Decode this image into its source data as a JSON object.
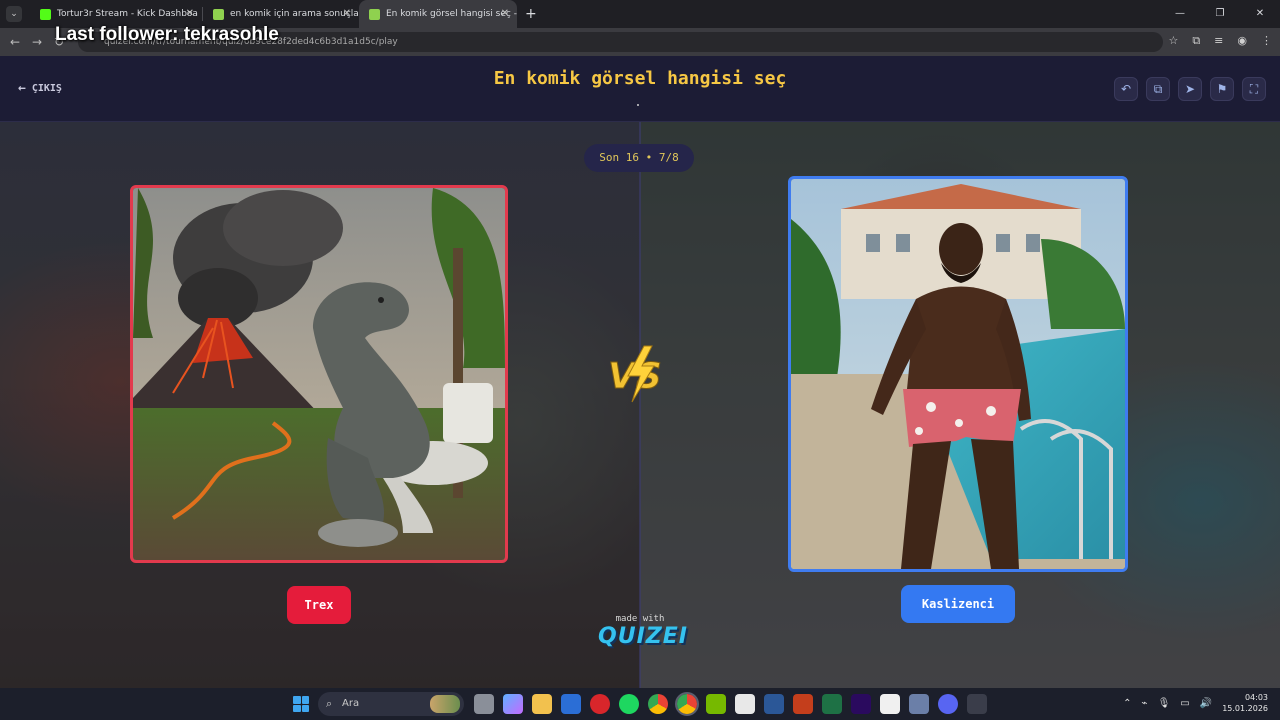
{
  "browser": {
    "tabs": [
      {
        "label": "Tortur3r Stream - Kick Dashboa",
        "favicon_color": "#53fc18"
      },
      {
        "label": "en komik için arama sonuçları -",
        "favicon_color": "#8fd14f"
      },
      {
        "label": "En komik görsel hangisi seç - T",
        "favicon_color": "#8fd14f",
        "active": true
      }
    ],
    "new_tab": "+",
    "url": "quizei.com/tr/tournament/quiz/6b9ce28f2ded4c6b3d1a1d5c/play"
  },
  "stream_overlay": {
    "text": "Last follower: tekrasohle"
  },
  "header": {
    "exit_label": "ÇIKIŞ",
    "title": "En komik görsel hangisi seç",
    "tools": [
      "undo-icon",
      "share-icon",
      "send-icon",
      "flag-icon",
      "fullscreen-icon"
    ]
  },
  "round": {
    "label": "Son 16 • 7/8"
  },
  "choices": {
    "left": {
      "label": "Trex",
      "color": "#e51c3b"
    },
    "right": {
      "label": "Kaslizenci",
      "color": "#3479f2"
    }
  },
  "vs_label": "VS",
  "branding": {
    "made_with": "made with",
    "logo": "QUIZEI"
  },
  "taskbar": {
    "search_placeholder": "Ara",
    "time": "04:03",
    "date": "15.01.2026"
  }
}
